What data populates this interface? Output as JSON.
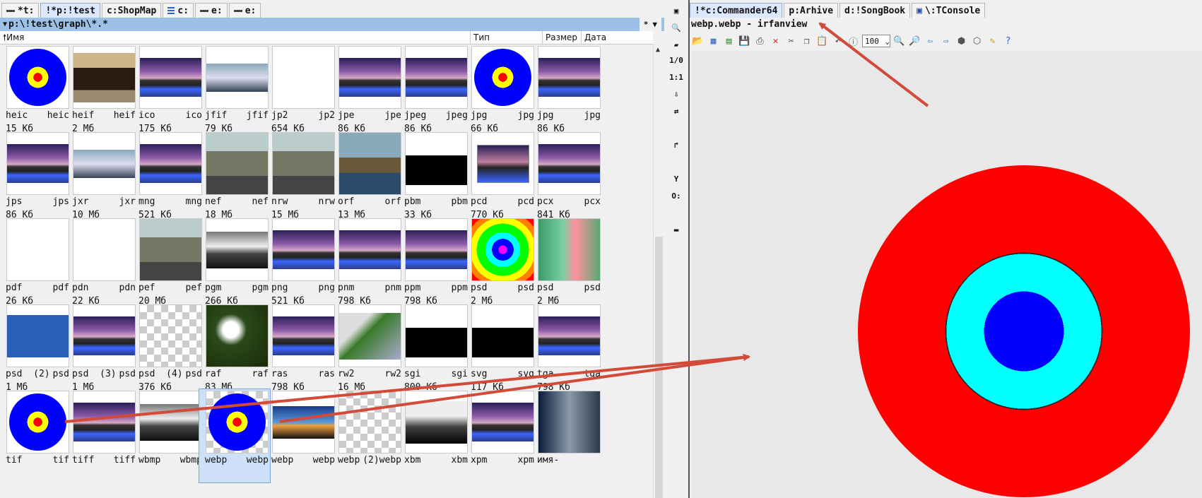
{
  "left": {
    "drive_tabs": [
      {
        "label": "*t:",
        "icon": "dash-icon"
      },
      {
        "label": "!*p:!test",
        "icon": "none",
        "active": true
      },
      {
        "label": "c:ShopMap",
        "icon": "none"
      },
      {
        "label": "c:",
        "icon": "tree-icon"
      },
      {
        "label": "e:",
        "icon": "dash-icon"
      },
      {
        "label": "e:",
        "icon": "dash-icon"
      }
    ],
    "path": "p:\\!test\\graph\\*.*",
    "path_menu": [
      "*",
      "▼"
    ],
    "columns": {
      "name": "Имя",
      "type": "Тип",
      "size": "Размер",
      "date": "Дата"
    },
    "files": [
      {
        "name": "heic",
        "ext": "heic",
        "size": "15 Кб",
        "thumb": "target"
      },
      {
        "name": "heif",
        "ext": "heif",
        "size": "2 Мб",
        "thumb": "moto"
      },
      {
        "name": "ico",
        "ext": "ico",
        "size": "175 Кб",
        "thumb": "land"
      },
      {
        "name": "jfif",
        "ext": "jfif",
        "size": "79 Кб",
        "thumb": "pano"
      },
      {
        "name": "jp2",
        "ext": "jp2",
        "size": "654 Кб",
        "thumb": "white"
      },
      {
        "name": "jpe",
        "ext": "jpe",
        "size": "86 Кб",
        "thumb": "land"
      },
      {
        "name": "jpeg",
        "ext": "jpeg",
        "size": "86 Кб",
        "thumb": "land"
      },
      {
        "name": "jpg",
        "ext": "jpg",
        "size": "66 Кб",
        "thumb": "target"
      },
      {
        "name": "jpg",
        "ext": "jpg",
        "size": "86 Кб",
        "thumb": "land"
      },
      {
        "name": "jps",
        "ext": "jps",
        "size": "86 Кб",
        "thumb": "land"
      },
      {
        "name": "jxr",
        "ext": "jxr",
        "size": "10 Мб",
        "thumb": "pano"
      },
      {
        "name": "mng",
        "ext": "mng",
        "size": "521 Кб",
        "thumb": "land"
      },
      {
        "name": "nef",
        "ext": "nef",
        "size": "18 Мб",
        "thumb": "city"
      },
      {
        "name": "nrw",
        "ext": "nrw",
        "size": "15 Мб",
        "thumb": "city"
      },
      {
        "name": "orf",
        "ext": "orf",
        "size": "13 Мб",
        "thumb": "boat"
      },
      {
        "name": "pbm",
        "ext": "pbm",
        "size": "33 Кб",
        "thumb": "bw"
      },
      {
        "name": "pcd",
        "ext": "pcd",
        "size": "770 Кб",
        "thumb": "pcd"
      },
      {
        "name": "pcx",
        "ext": "pcx",
        "size": "841 Кб",
        "thumb": "land"
      },
      {
        "name": "pdf",
        "ext": "pdf",
        "size": "26 Кб",
        "thumb": "white"
      },
      {
        "name": "pdn",
        "ext": "pdn",
        "size": "22 Кб",
        "thumb": "white"
      },
      {
        "name": "pef",
        "ext": "pef",
        "size": "20 Мб",
        "thumb": "city"
      },
      {
        "name": "pgm",
        "ext": "pgm",
        "size": "266 Кб",
        "thumb": "gray"
      },
      {
        "name": "png",
        "ext": "png",
        "size": "521 Кб",
        "thumb": "land"
      },
      {
        "name": "pnm",
        "ext": "pnm",
        "size": "798 Кб",
        "thumb": "land"
      },
      {
        "name": "ppm",
        "ext": "ppm",
        "size": "798 Кб",
        "thumb": "land"
      },
      {
        "name": "psd",
        "ext": "psd",
        "size": "2 Мб",
        "thumb": "psdrad"
      },
      {
        "name": "psd",
        "ext": "psd",
        "size": "2 Мб",
        "thumb": "rocket"
      },
      {
        "name": "psd  (2)",
        "ext": "psd",
        "size": "1 Мб",
        "thumb": "plane"
      },
      {
        "name": "psd  (3)",
        "ext": "psd",
        "size": "1 Мб",
        "thumb": "land"
      },
      {
        "name": "psd  (4)",
        "ext": "psd",
        "size": "376 Кб",
        "thumb": "check"
      },
      {
        "name": "raf",
        "ext": "raf",
        "size": "83 Мб",
        "thumb": "flower"
      },
      {
        "name": "ras",
        "ext": "ras",
        "size": "798 Кб",
        "thumb": "land"
      },
      {
        "name": "rw2",
        "ext": "rw2",
        "size": "16 Мб",
        "thumb": "plant"
      },
      {
        "name": "sgi",
        "ext": "sgi",
        "size": "800 Кб",
        "thumb": "bw"
      },
      {
        "name": "svg",
        "ext": "svg",
        "size": "117 Кб",
        "thumb": "bw"
      },
      {
        "name": "tga",
        "ext": "tga",
        "size": "798 Кб",
        "thumb": "land"
      },
      {
        "name": "tif",
        "ext": "tif",
        "size": "",
        "thumb": "target"
      },
      {
        "name": "tiff",
        "ext": "tiff",
        "size": "",
        "thumb": "land"
      },
      {
        "name": "wbmp",
        "ext": "wbmp",
        "size": "",
        "thumb": "gray"
      },
      {
        "name": "webp",
        "ext": "webp",
        "size": "",
        "thumb": "target",
        "selected": true
      },
      {
        "name": "webp",
        "ext": "webp",
        "size": "",
        "thumb": "beach"
      },
      {
        "name": "webp",
        "ext": "(2)webp",
        "size": "",
        "thumb": "check"
      },
      {
        "name": "xbm",
        "ext": "xbm",
        "size": "",
        "thumb": "xbm"
      },
      {
        "name": "xpm",
        "ext": "xpm",
        "size": "",
        "thumb": "land"
      },
      {
        "name": "имя-",
        "ext": "",
        "size": "",
        "thumb": "face"
      }
    ]
  },
  "middle_toolbar": {
    "buttons": [
      {
        "name": "viewer-icon",
        "glyph": "▣"
      },
      {
        "name": "magnifier-icon",
        "glyph": "🔍"
      },
      {
        "name": "eraser-icon",
        "glyph": "▰"
      },
      {
        "name": "ratio-icon",
        "glyph": "1/0"
      },
      {
        "name": "one-to-one-icon",
        "glyph": "1:1"
      },
      {
        "name": "download-icon",
        "glyph": "⇩"
      },
      {
        "name": "swap-icon",
        "glyph": "⇄"
      },
      {
        "name": "exit-icon",
        "glyph": "↱"
      },
      {
        "name": "yandex-icon",
        "glyph": "Y"
      },
      {
        "name": "circle-o-icon",
        "glyph": "O:"
      },
      {
        "name": "console-icon",
        "glyph": "▬"
      }
    ]
  },
  "right": {
    "tabs": [
      {
        "label": "!*c:Commander64",
        "active": true
      },
      {
        "label": "p:Arhive",
        "active": false
      },
      {
        "label": "d:!SongBook",
        "active": false
      },
      {
        "label": "\\:TConsole",
        "active": false,
        "icon": "console-icon"
      }
    ],
    "viewer_title": "webp.webp - irfanview",
    "zoom_value": "100",
    "toolbar_buttons": [
      {
        "name": "open-folder-icon",
        "glyph": "📂",
        "color": "#d89a20"
      },
      {
        "name": "thumbnails-icon",
        "glyph": "▦",
        "color": "#3a66c8"
      },
      {
        "name": "slideshow-icon",
        "glyph": "▤",
        "color": "#3a8a3a"
      },
      {
        "name": "save-icon",
        "glyph": "💾",
        "color": "#2a4aa8"
      },
      {
        "name": "print-icon",
        "glyph": "⎙",
        "color": "#444"
      },
      {
        "name": "delete-icon",
        "glyph": "✕",
        "color": "#d02020"
      },
      {
        "name": "cut-icon",
        "glyph": "✂",
        "color": "#444"
      },
      {
        "name": "copy-icon",
        "glyph": "❐",
        "color": "#444"
      },
      {
        "name": "paste-icon",
        "glyph": "📋",
        "color": "#b07a10"
      },
      {
        "name": "undo-icon",
        "glyph": "↶",
        "color": "#444"
      },
      {
        "name": "info-icon",
        "glyph": "ⓘ",
        "color": "#2a8a2a"
      }
    ],
    "toolbar_buttons_after_zoom": [
      {
        "name": "zoom-in-icon",
        "glyph": "🔍",
        "color": "#2a4aa8"
      },
      {
        "name": "zoom-out-icon",
        "glyph": "🔎",
        "color": "#2a4aa8"
      },
      {
        "name": "prev-icon",
        "glyph": "⇦",
        "color": "#2a6ad8"
      },
      {
        "name": "next-icon",
        "glyph": "⇨",
        "color": "#2a6ad8"
      },
      {
        "name": "filmstrip-icon",
        "glyph": "⬢",
        "color": "#555"
      },
      {
        "name": "effects-icon",
        "glyph": "⬡",
        "color": "#555"
      },
      {
        "name": "paint-icon",
        "glyph": "✎",
        "color": "#d89a20"
      },
      {
        "name": "help-icon",
        "glyph": "?",
        "color": "#2a6ad8"
      }
    ]
  },
  "colors": {
    "arrow": "#d24a3a",
    "path_bar": "#9cc0e6",
    "selection": "#cde0f7"
  }
}
